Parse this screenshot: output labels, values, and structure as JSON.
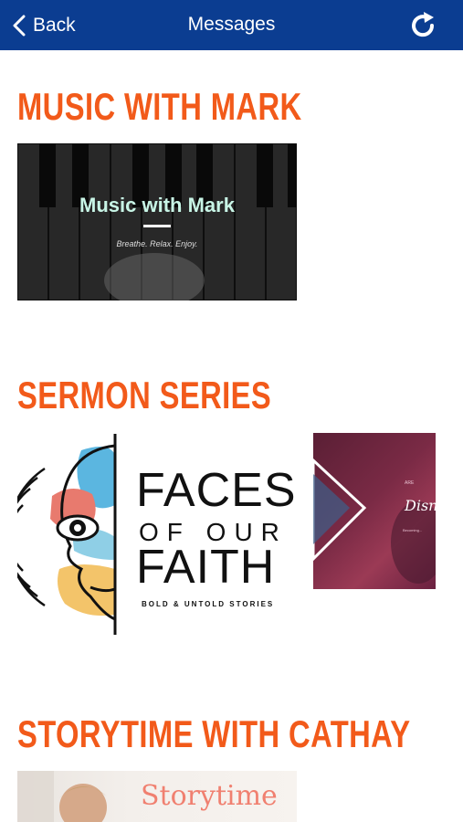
{
  "navbar": {
    "back_label": "Back",
    "title": "Messages",
    "icons": {
      "back": "chevron-left-icon",
      "refresh": "refresh-icon"
    },
    "background": "#0b3d91"
  },
  "sections": [
    {
      "title": "MUSIC WITH MARK",
      "cards": [
        {
          "title": "Music with Mark",
          "subtitle": "Breathe. Relax. Enjoy."
        }
      ]
    },
    {
      "title": "SERMON SERIES",
      "cards": [
        {
          "line1": "FACES",
          "line2": "OF OUR",
          "line3": "FAITH",
          "subtitle": "BOLD & UNTOLD STORIES"
        },
        {
          "title": "Disne",
          "small": "ARE",
          "line": "Becoming..."
        }
      ]
    },
    {
      "title": "STORYTIME WITH CATHAY",
      "cards": [
        {
          "title": "Storytime"
        }
      ]
    }
  ],
  "colors": {
    "accent": "#f25a1a"
  }
}
